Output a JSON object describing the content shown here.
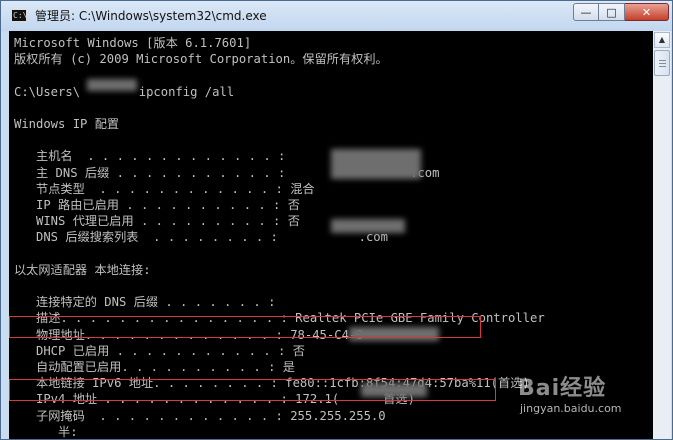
{
  "window": {
    "title": "管理员: C:\\Windows\\system32\\cmd.exe",
    "icon": "cmd-icon"
  },
  "controls": {
    "minimize": "—",
    "maximize": "□",
    "close": "✕"
  },
  "console": {
    "lines": [
      "Microsoft Windows [版本 6.1.7601]",
      "版权所有 (c) 2009 Microsoft Corporation。保留所有权利。",
      "",
      "C:\\Users\\        ipconfig /all",
      "",
      "Windows IP 配置",
      "",
      "   主机名  . . . . . . . . . . . . . :",
      "   主 DNS 后缀 . . . . . . . . . . . :                 .com",
      "   节点类型  . . . . . . . . . . . . : 混合",
      "   IP 路由已启用 . . . . . . . . . . : 否",
      "   WINS 代理已启用 . . . . . . . . . : 否",
      "   DNS 后缀搜索列表  . . . . . . . . :           .com",
      "",
      "以太网适配器 本地连接:",
      "",
      "   连接特定的 DNS 后缀 . . . . . . . :",
      "   描述. . . . . . . . . . . . . . . : Realtek PCIe GBE Family Controller",
      "   物理地址. . . . . . . . . . . . . : 78-45-C4-3",
      "   DHCP 已启用 . . . . . . . . . . . : 否",
      "   自动配置已启用. . . . . . . . . . : 是",
      "   本地链接 IPv6 地址. . . . . . . . : fe80::1cfb:8f54:47d4:57ba%11(首选)",
      "   IPv4 地址 . . . . . . . . . . . . : 172.1(      首选)",
      "   子网掩码  . . . . . . . . . . . . : 255.255.255.0",
      "      半:"
    ]
  },
  "watermark": {
    "logo": "Bai经验",
    "domain": "jingyan.baidu.com"
  }
}
